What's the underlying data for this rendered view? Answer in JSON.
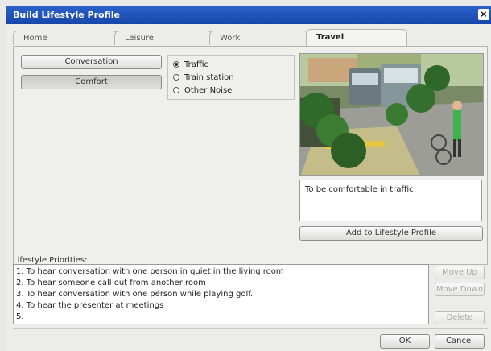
{
  "window": {
    "title": "Build Lifestyle Profile",
    "close_label": "×"
  },
  "tabs": [
    {
      "label": "Home",
      "active": false
    },
    {
      "label": "Leisure",
      "active": false
    },
    {
      "label": "Work",
      "active": false
    },
    {
      "label": "Travel",
      "active": true
    }
  ],
  "travel": {
    "buttons": [
      {
        "label": "Conversation",
        "pressed": false
      },
      {
        "label": "Comfort",
        "pressed": true
      }
    ],
    "radios": [
      {
        "label": "Traffic",
        "checked": true
      },
      {
        "label": "Train station",
        "checked": false
      },
      {
        "label": "Other Noise",
        "checked": false
      }
    ],
    "description": "To be comfortable in traffic",
    "add_button": "Add to Lifestyle Profile"
  },
  "priorities": {
    "label": "Lifestyle Priorities:",
    "items": [
      "1. To hear conversation with one person in quiet in the living room",
      "2. To hear someone call out from another room",
      "3. To hear conversation with one person while playing golf.",
      "4. To hear the presenter at meetings",
      "5."
    ]
  },
  "side_buttons": {
    "move_up": "Move Up",
    "move_down": "Move Down",
    "delete": "Delete"
  },
  "footer": {
    "ok": "OK",
    "cancel": "Cancel"
  },
  "colors": {
    "titlebar": "#1f55bd",
    "window_bg": "#ecece9"
  }
}
